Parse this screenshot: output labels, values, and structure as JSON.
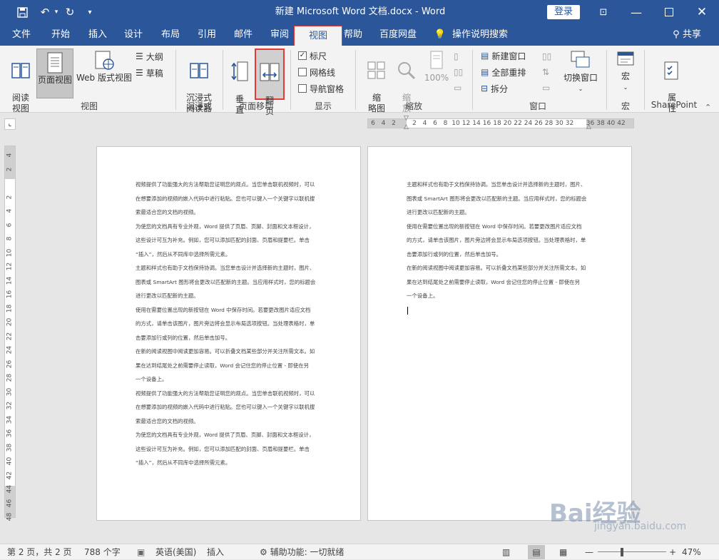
{
  "titlebar": {
    "title": "新建 Microsoft Word 文档.docx - Word",
    "login": "登录"
  },
  "tabs": [
    "文件",
    "开始",
    "插入",
    "设计",
    "布局",
    "引用",
    "邮件",
    "审阅",
    "视图",
    "帮助",
    "百度网盘",
    "操作说明搜索"
  ],
  "share": "共享",
  "ribbon": {
    "views": {
      "read": "阅读\n视图",
      "print": "页面视图",
      "web": "Web 版式视图",
      "outline": "大纲",
      "draft": "草稿",
      "label": "视图"
    },
    "immersive": {
      "reader": "沉浸式\n阅读器",
      "label": "沉浸式"
    },
    "movement": {
      "vertical": "垂\n直",
      "flip": "翻\n页",
      "label": "页面移动"
    },
    "show": {
      "ruler": "标尺",
      "gridlines": "网格线",
      "nav": "导航窗格",
      "label": "显示"
    },
    "zoom": {
      "layout": "缩\n略图",
      "zoom": "缩\n放",
      "pct": "100%",
      "label": "缩放"
    },
    "window": {
      "new": "新建窗口",
      "arrange": "全部重排",
      "split": "拆分",
      "switch": "切换窗口",
      "label": "窗口"
    },
    "macros": {
      "macro": "宏",
      "label": "宏"
    },
    "sharepoint": {
      "props": "属\n性",
      "label": "SharePoint"
    }
  },
  "ruler_h": [
    "6",
    "4",
    "2",
    "",
    "2",
    "4",
    "6",
    "8",
    "10",
    "12",
    "14",
    "16",
    "18",
    "20",
    "22",
    "24",
    "26",
    "28",
    "30",
    "32",
    "",
    "36",
    "38",
    "40",
    "42"
  ],
  "ruler_v": [
    "4",
    "2",
    "",
    "2",
    "4",
    "6",
    "8",
    "10",
    "12",
    "14",
    "16",
    "18",
    "20",
    "22",
    "24",
    "26",
    "28",
    "30",
    "32",
    "34",
    "36",
    "38",
    "40",
    "42",
    "44",
    "46",
    "48"
  ],
  "page1_lines": [
    "视频提供了功能强大的方法帮助您证明您的观点。当您单击联机视频时，可以",
    "在想要添加的视频的嵌入代码中进行粘贴。您也可以键入一个关键字以联机搜",
    "索最适合您的文档的视频。",
    "为使您的文档具有专业外观，Word 提供了页眉、页脚、封面和文本框设计，",
    "这些设计可互为补充。例如，您可以添加匹配的封面、页眉和提要栏。单击",
    "“插入”，然后从不同库中选择所需元素。",
    "主题和样式也有助于文档保持协调。当您单击设计并选择新的主题时，图片、",
    "图表或 SmartArt 图形将会更改以匹配新的主题。当应用样式时，您的标题会",
    "进行更改以匹配新的主题。",
    "使用在需要位置出现的新按钮在 Word 中保存时间。若要更改图片适应文档",
    "的方式，请单击该图片，图片旁边将会显示布局选项按钮。当处理表格时，单",
    "击要添加行或列的位置，然后单击加号。",
    "在新的阅读视图中阅读更加容易。可以折叠文档某些部分并关注所需文本。如",
    "果在达到结尾处之前需要停止读取，Word 会记住您的停止位置 - 即使在另",
    "一个设备上。",
    "视频提供了功能强大的方法帮助您证明您的观点。当您单击联机视频时，可以",
    "在想要添加的视频的嵌入代码中进行粘贴。您也可以键入一个关键字以联机搜",
    "索最适合您的文档的视频。",
    "为使您的文档具有专业外观，Word 提供了页眉、页脚、封面和文本框设计，",
    "这些设计可互为补充。例如，您可以添加匹配的封面、页眉和提要栏。单击",
    "“插入”，然后从不同库中选择所需元素。"
  ],
  "page2_lines": [
    "主题和样式也有助于文档保持协调。当您单击设计并选择新的主题时，图片、",
    "图表或 SmartArt 图形将会更改以匹配新的主题。当应用样式时，您的标题会",
    "进行更改以匹配新的主题。",
    "使用在需要位置出现的新按钮在 Word 中保存时间。若要更改图片适应文档",
    "的方式，请单击该图片，图片旁边将会显示布局选项按钮。当处理表格时，单",
    "击要添加行或列的位置，然后单击加号。",
    "在新的阅读视图中阅读更加容易。可以折叠文档某些部分并关注所需文本。如",
    "果在达到结尾处之前需要停止读取，Word 会记住您的停止位置 - 即使在另",
    "一个设备上。"
  ],
  "status": {
    "page": "第 2 页，共 2 页",
    "words": "788 个字",
    "lang": "英语(美国)",
    "mode": "插入",
    "access": "辅助功能: 一切就绪",
    "zoom": "47%"
  },
  "watermark": {
    "main": "Bai经验",
    "sub": "jingyan.baidu.com"
  },
  "colors": {
    "accent": "#2b579a",
    "highlight": "#e53935"
  }
}
